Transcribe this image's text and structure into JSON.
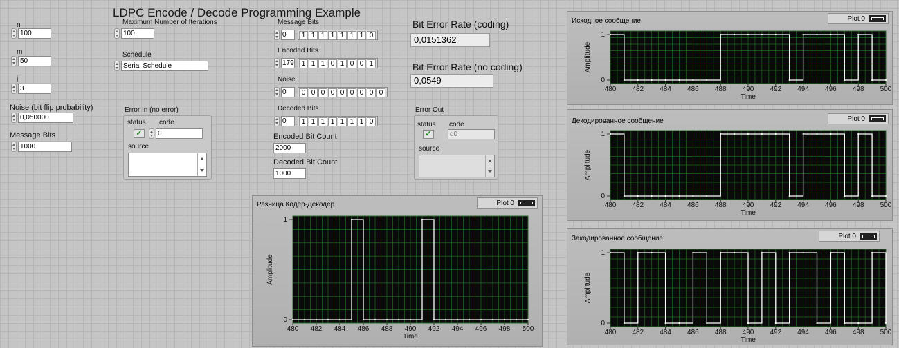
{
  "title": "LDPC  Encode / Decode Programming Example",
  "controls": {
    "n": {
      "label": "n",
      "value": "100"
    },
    "m": {
      "label": "m",
      "value": "50"
    },
    "j": {
      "label": "j",
      "value": "3"
    },
    "noise_prob": {
      "label": "Noise (bit flip probability)",
      "value": "0,050000"
    },
    "message_bits": {
      "label": "Message Bits",
      "value": "1000"
    },
    "max_iter": {
      "label": "Maximum Number of Iterations",
      "value": "100"
    },
    "schedule": {
      "label": "Schedule",
      "value": "Serial Schedule"
    }
  },
  "error_in": {
    "label": "Error In (no error)",
    "status_label": "status",
    "code_label": "code",
    "code": "0",
    "source_label": "source",
    "status_glyph": "✓"
  },
  "error_out": {
    "label": "Error Out",
    "status_label": "status",
    "code_label": "code",
    "code": "d0",
    "source_label": "source",
    "status_glyph": "✓"
  },
  "arrays": {
    "message_bits": {
      "label": "Message Bits",
      "index": "0",
      "values": [
        "1",
        "1",
        "1",
        "1",
        "1",
        "1",
        "1",
        "0"
      ]
    },
    "encoded_bits": {
      "label": "Encoded Bits",
      "index": "179",
      "values": [
        "1",
        "1",
        "1",
        "0",
        "1",
        "0",
        "0",
        "1"
      ]
    },
    "noise": {
      "label": "Noise",
      "index": "0",
      "values": [
        "0",
        "0",
        "0",
        "0",
        "0",
        "0",
        "0",
        "0",
        "0"
      ]
    },
    "decoded_bits": {
      "label": "Decoded Bits",
      "index": "0",
      "values": [
        "1",
        "1",
        "1",
        "1",
        "1",
        "1",
        "1",
        "0"
      ]
    }
  },
  "indicators": {
    "encoded_count": {
      "label": "Encoded Bit Count",
      "value": "2000"
    },
    "decoded_count": {
      "label": "Decoded Bit Count",
      "value": "1000"
    },
    "ber_coding": {
      "label": "Bit Error Rate (coding)",
      "value": "0,0151362"
    },
    "ber_nocoding": {
      "label": "Bit Error Rate (no coding)",
      "value": "0,0549"
    }
  },
  "colors": {
    "plot_bg": "#0a0a0a",
    "grid": "#1e6b1e",
    "trace": "#ffffff",
    "panel": "#c5c5c5",
    "status_ok": "#1b8a1b"
  },
  "chart_data": [
    {
      "id": "g1",
      "type": "line",
      "step": true,
      "title": "Исходное сообщение",
      "legend": "Plot 0",
      "xlabel": "Time",
      "ylabel": "Amplitude",
      "xlim": [
        480,
        500
      ],
      "ylim": [
        0,
        1
      ],
      "xticks": [
        "480",
        "482",
        "484",
        "486",
        "488",
        "490",
        "492",
        "494",
        "496",
        "498",
        "500"
      ],
      "yticks": [
        "0",
        "1"
      ],
      "x": [
        480,
        481,
        482,
        483,
        484,
        485,
        486,
        487,
        488,
        489,
        490,
        491,
        492,
        493,
        494,
        495,
        496,
        497,
        498,
        499,
        500
      ],
      "y": [
        1,
        0,
        0,
        0,
        0,
        0,
        0,
        0,
        1,
        1,
        1,
        1,
        1,
        0,
        1,
        1,
        1,
        0,
        1,
        0,
        0
      ]
    },
    {
      "id": "g2",
      "type": "line",
      "step": true,
      "title": "Декодированное сообщение",
      "legend": "Plot 0",
      "xlabel": "Time",
      "ylabel": "Amplitude",
      "xlim": [
        480,
        500
      ],
      "ylim": [
        0,
        1
      ],
      "xticks": [
        "480",
        "482",
        "484",
        "486",
        "488",
        "490",
        "492",
        "494",
        "496",
        "498",
        "500"
      ],
      "yticks": [
        "0",
        "1"
      ],
      "x": [
        480,
        481,
        482,
        483,
        484,
        485,
        486,
        487,
        488,
        489,
        490,
        491,
        492,
        493,
        494,
        495,
        496,
        497,
        498,
        499,
        500
      ],
      "y": [
        1,
        0,
        0,
        0,
        0,
        0,
        0,
        0,
        1,
        1,
        1,
        1,
        1,
        0,
        1,
        1,
        1,
        0,
        1,
        0,
        0
      ]
    },
    {
      "id": "g3",
      "type": "line",
      "step": true,
      "title": "Закодированное сообщение",
      "legend": "Plot 0",
      "xlabel": "Time",
      "ylabel": "Amplitude",
      "xlim": [
        480,
        500
      ],
      "ylim": [
        0,
        1
      ],
      "xticks": [
        "480",
        "482",
        "484",
        "486",
        "488",
        "490",
        "492",
        "494",
        "496",
        "498",
        "500"
      ],
      "yticks": [
        "0",
        "1"
      ],
      "x": [
        480,
        481,
        482,
        483,
        484,
        485,
        486,
        487,
        488,
        489,
        490,
        491,
        492,
        493,
        494,
        495,
        496,
        497,
        498,
        499,
        500
      ],
      "y": [
        1,
        0,
        1,
        1,
        0,
        0,
        1,
        0,
        1,
        1,
        0,
        1,
        0,
        1,
        1,
        0,
        1,
        0,
        0,
        1,
        0
      ]
    },
    {
      "id": "g4",
      "type": "line",
      "step": true,
      "title": "Разница Кодер-Декодер",
      "legend": "Plot 0",
      "xlabel": "Time",
      "ylabel": "Amplitude",
      "xlim": [
        480,
        500
      ],
      "ylim": [
        0,
        1
      ],
      "xticks": [
        "480",
        "482",
        "484",
        "486",
        "488",
        "490",
        "492",
        "494",
        "496",
        "498",
        "500"
      ],
      "yticks": [
        "0",
        "1"
      ],
      "x": [
        480,
        481,
        482,
        483,
        484,
        485,
        486,
        487,
        488,
        489,
        490,
        491,
        492,
        493,
        494,
        495,
        496,
        497,
        498,
        499,
        500
      ],
      "y": [
        0,
        0,
        0,
        0,
        0,
        1,
        0,
        0,
        0,
        0,
        0,
        1,
        0,
        0,
        0,
        0,
        0,
        0,
        0,
        0,
        0
      ]
    }
  ]
}
